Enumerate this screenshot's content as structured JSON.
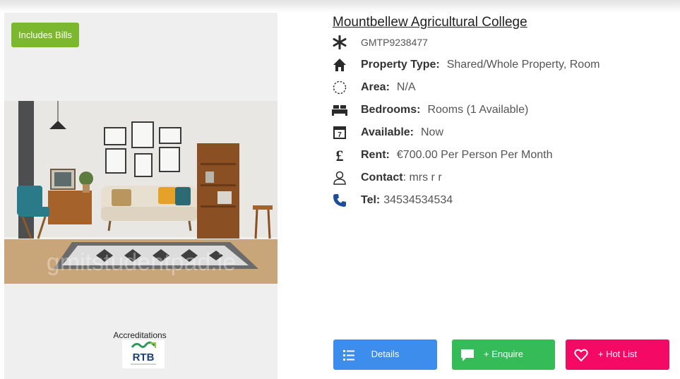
{
  "badge": {
    "label": "Includes Bills"
  },
  "listing": {
    "title": "Mountbellew Agricultural College",
    "code": "GMTP9238477",
    "property_type_label": "Property Type:",
    "property_type_value": "Shared/Whole Property, Room",
    "area_label": "Area:",
    "area_value": "N/A",
    "bedrooms_label": "Bedrooms:",
    "bedrooms_value": "Rooms (1 Available)",
    "available_label": "Available:",
    "available_value": "Now",
    "rent_label": "Rent:",
    "rent_value": "€700.00 Per Person Per Month",
    "contact_label": "Contact",
    "contact_value": ": mrs r r",
    "tel_label": "Tel:",
    "tel_value": "34534534534"
  },
  "photo": {
    "watermark": "gmitstudentpad.ie"
  },
  "accreditations": {
    "label": "Accreditations",
    "logo_text": "RTB"
  },
  "buttons": {
    "details": "Details",
    "enquire": "+ Enquire",
    "hotlist": "+ Hot List"
  },
  "icons": {
    "code": "asterisk-icon",
    "property_type": "home-icon",
    "area": "dashed-circle-icon",
    "bedrooms": "bed-icon",
    "available": "calendar-icon",
    "rent": "pound-icon",
    "contact": "user-icon",
    "tel": "phone-icon"
  },
  "colors": {
    "badge": "#7cb82f",
    "details": "#3d8eec",
    "enquire": "#35bb57",
    "hotlist": "#f40965",
    "phone_icon": "#1e4e9b"
  }
}
